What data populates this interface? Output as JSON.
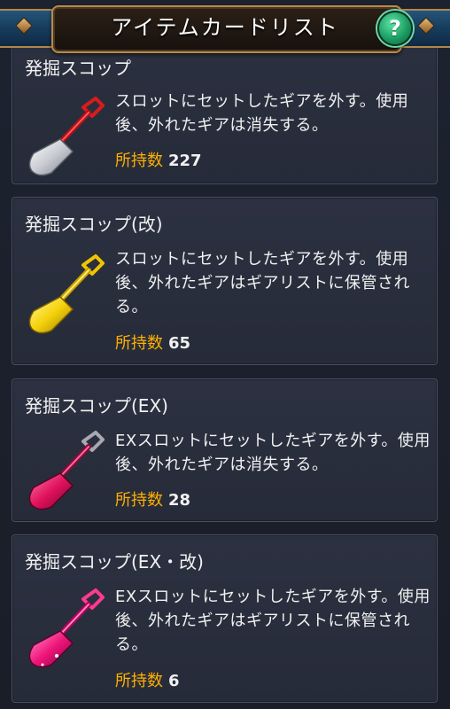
{
  "header": {
    "title": "アイテムカードリスト",
    "help_label": "?"
  },
  "items": [
    {
      "name": "発掘スコップ",
      "description": "スロットにセットしたギアを外す。使用後、外れたギアは消失する。",
      "count_label": "所持数",
      "count": "227",
      "icon": "silver-shovel-icon"
    },
    {
      "name": "発掘スコップ(改)",
      "description": "スロットにセットしたギアを外す。使用後、外れたギアはギアリストに保管される。",
      "count_label": "所持数",
      "count": "65",
      "icon": "gold-shovel-icon"
    },
    {
      "name": "発掘スコップ(EX)",
      "description": "EXスロットにセットしたギアを外す。使用後、外れたギアは消失する。",
      "count_label": "所持数",
      "count": "28",
      "icon": "crimson-shovel-icon"
    },
    {
      "name": "発掘スコップ(EX・改)",
      "description": "EXスロットにセットしたギアを外す。使用後、外れたギアはギアリストに保管される。",
      "count_label": "所持数",
      "count": "6",
      "icon": "magenta-shovel-icon"
    }
  ],
  "colors": {
    "count_label": "#ffb000",
    "card_background": "#2a2f3e",
    "header_band": "#1b4566",
    "help_button": "#1c9d63"
  }
}
